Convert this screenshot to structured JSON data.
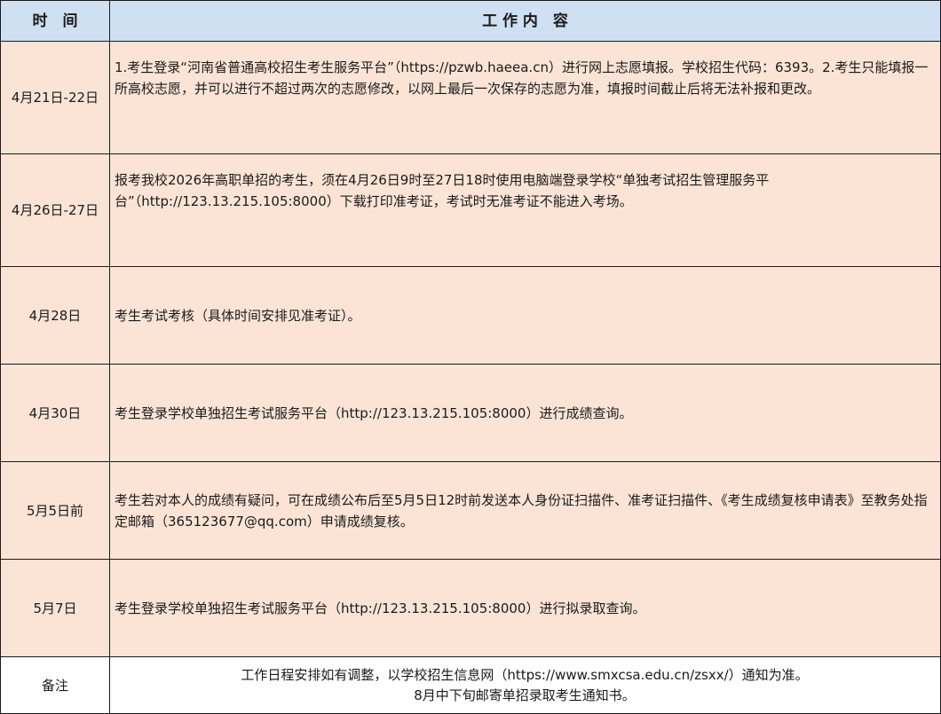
{
  "table": {
    "headers": {
      "time": "时　间",
      "content": "工 作 内　容"
    },
    "rows": [
      {
        "date": "4月21日-22日",
        "content": "1.考生登录“河南省普通高校招生考生服务平台”（https://pzwb.haeea.cn）进行网上志愿填报。学校招生代码：6393。2.考生只能填报一所高校志愿，并可以进行不超过两次的志愿修改，以网上最后一次保存的志愿为准，填报时间截止后将无法补报和更改。"
      },
      {
        "date": "4月26日-27日",
        "content": "报考我校2026年高职单招的考生，须在4月26日9时至27日18时使用电脑端登录学校“单独考试招生管理服务平台”（http://123.13.215.105:8000）下载打印准考证，考试时无准考证不能进入考场。"
      },
      {
        "date": "4月28日",
        "content": "考生考试考核（具体时间安排见准考证）。"
      },
      {
        "date": "4月30日",
        "content": "考生登录学校单独招生考试服务平台（http://123.13.215.105:8000）进行成绩查询。"
      },
      {
        "date": "5月5日前",
        "content": "考生若对本人的成绩有疑问，可在成绩公布后至5月5日12时前发送本人身份证扫描件、准考证扫描件、《考生成绩复核申请表》至教务处指定邮箱（365123677@qq.com）申请成绩复核。"
      },
      {
        "date": "5月7日",
        "content": "考生登录学校单独招生考试服务平台（http://123.13.215.105:8000）进行拟录取查询。"
      }
    ],
    "note": {
      "label": "备注",
      "line1": "工作日程安排如有调整，以学校招生信息网（https://www.smxcsa.edu.cn/zsxx/）通知为准。",
      "line2": "8月中下旬邮寄单招录取考生通知书。"
    },
    "colors": {
      "header_bg": "#cfe0f3",
      "row_bg": "#fbe4d6",
      "border": "#1a1a1a"
    }
  }
}
